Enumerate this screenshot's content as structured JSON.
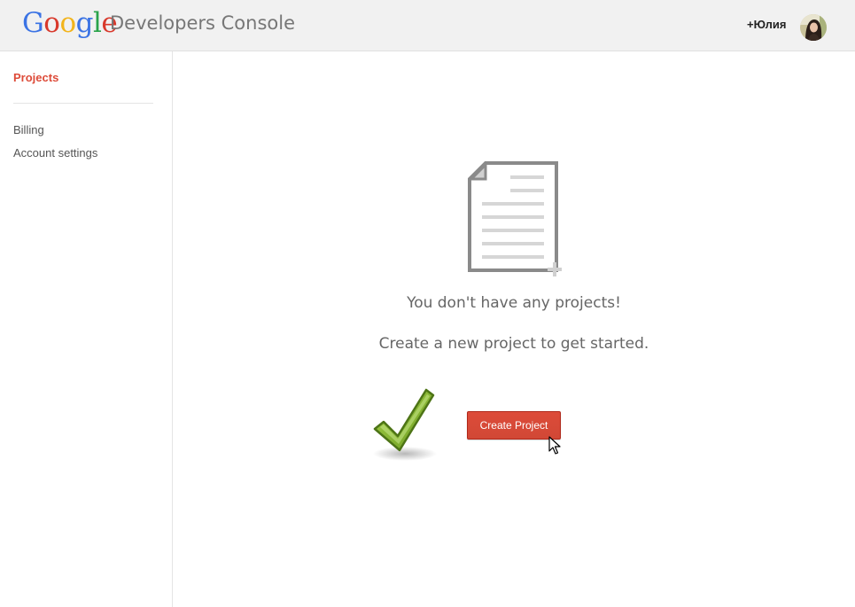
{
  "header": {
    "logo_letters": [
      "G",
      "o",
      "o",
      "g",
      "l",
      "e"
    ],
    "product_name": "Developers Console",
    "user_name": "+Юлия",
    "avatar_icon": "user-avatar-icon"
  },
  "sidebar": {
    "active_item": "Projects",
    "items": [
      {
        "label": "Billing"
      },
      {
        "label": "Account settings"
      }
    ]
  },
  "main": {
    "empty_icon": "document-add-icon",
    "empty_title": "You don't have any projects!",
    "empty_subtitle": "Create a new project to get started.",
    "decoration_icon": "green-checkmark-icon",
    "create_button_label": "Create Project"
  },
  "colors": {
    "accent_red": "#dd4b39",
    "header_bg": "#f1f1f1",
    "text_gray": "#666666"
  }
}
